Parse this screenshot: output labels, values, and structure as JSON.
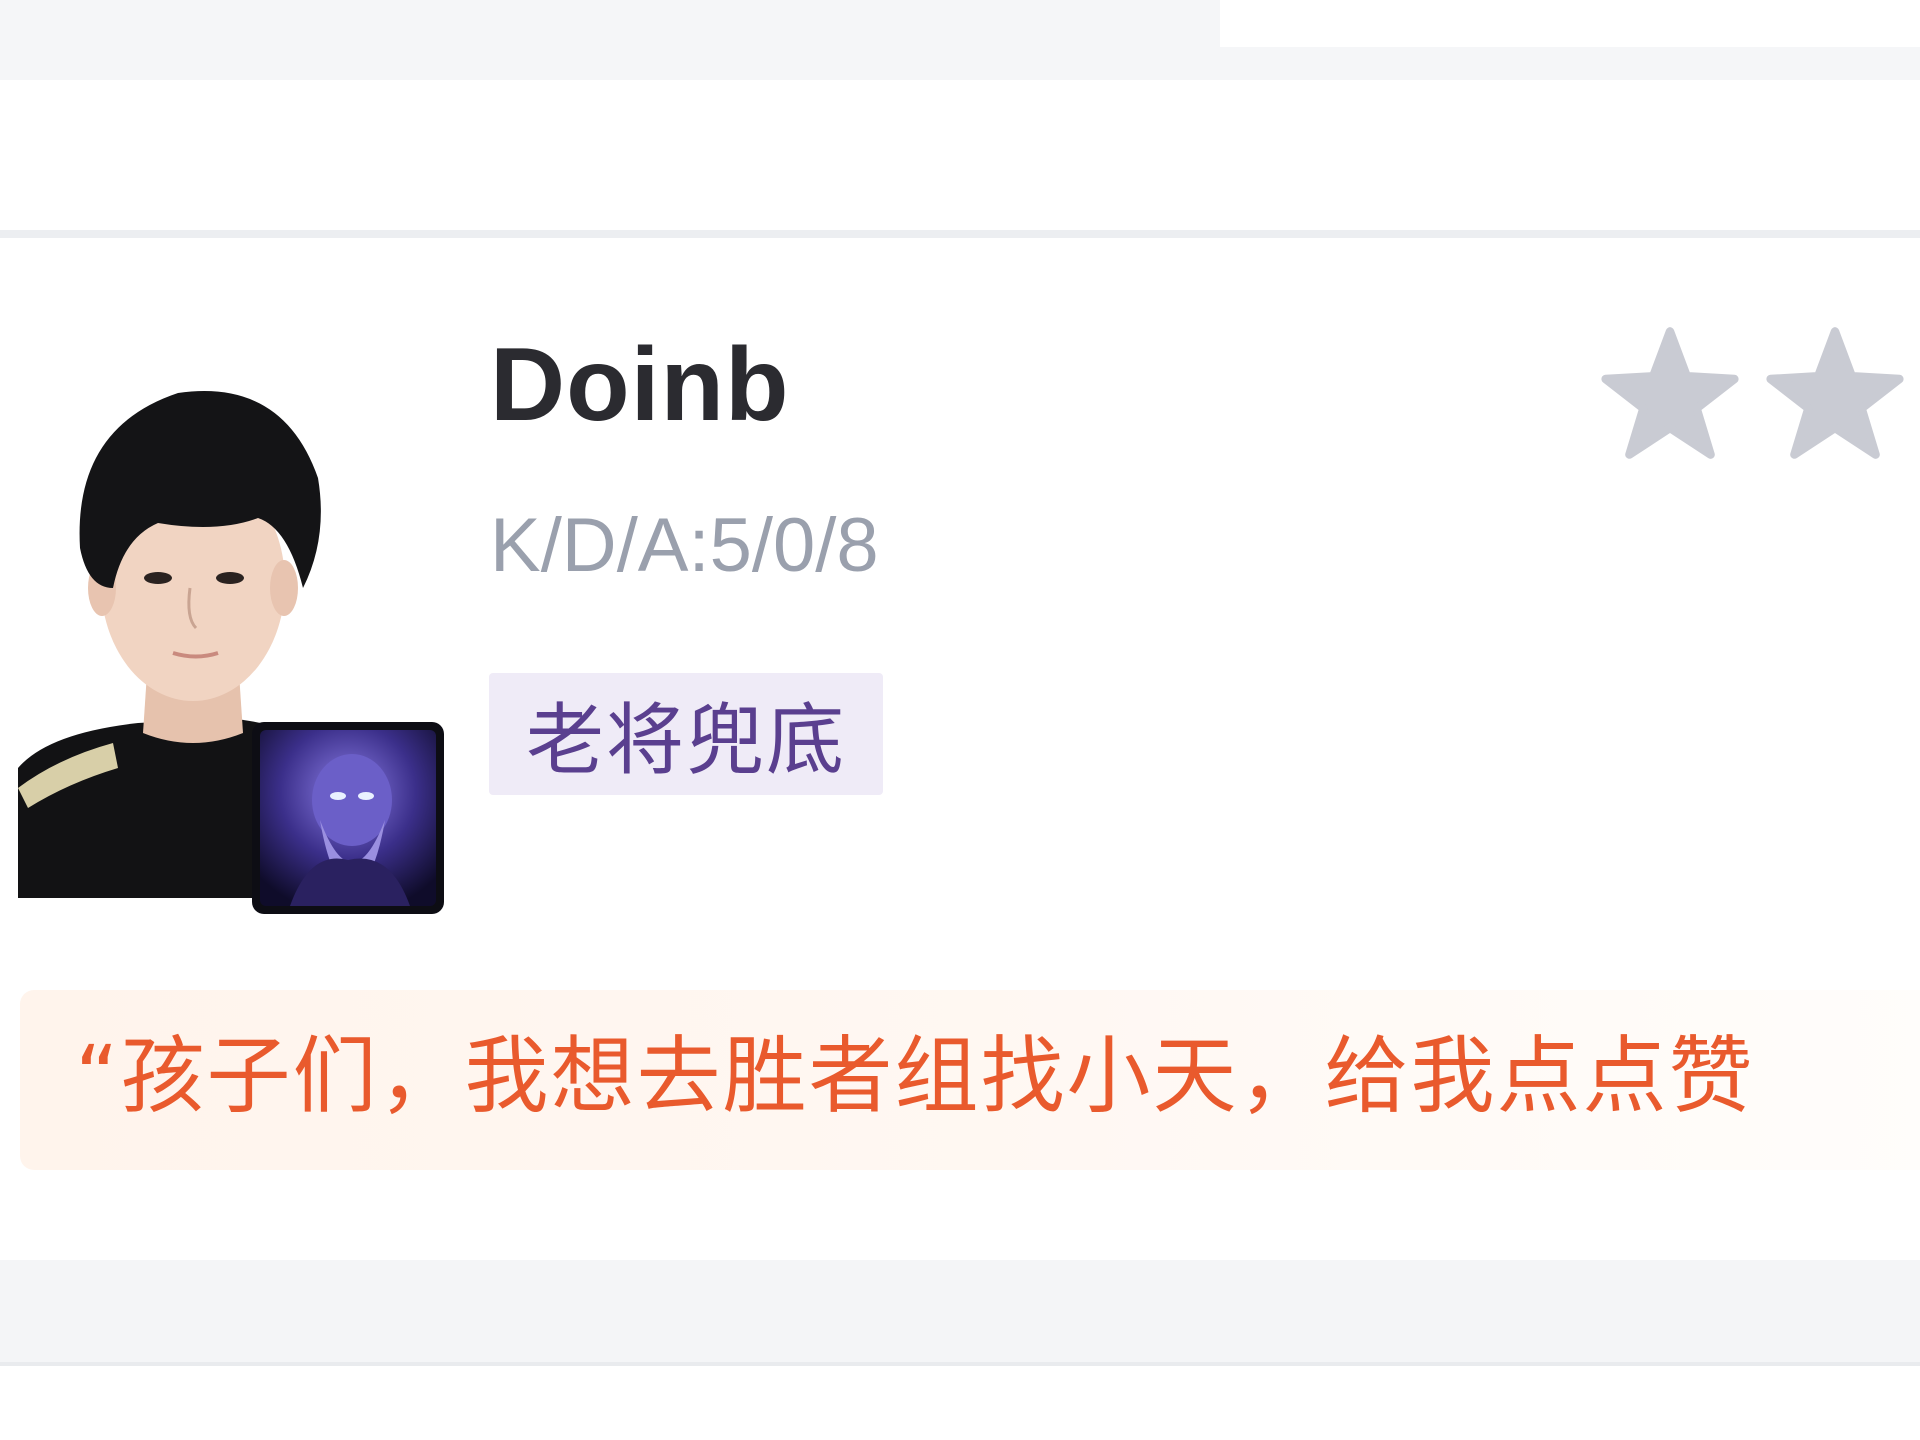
{
  "player": {
    "name": "Doinb",
    "kda": "K/D/A:5/0/8",
    "tag": "老将兜底",
    "avatar_icon": "player-avatar",
    "champion_icon": "champion-icon"
  },
  "rating": {
    "stars_visible": 2,
    "star_color": "#c9cbd3"
  },
  "quote": {
    "text": "“孩子们，我想去胜者组找小天，给我点点赞"
  },
  "colors": {
    "name": "#2b2b30",
    "kda": "#9aa0ad",
    "tag_bg": "#efebf7",
    "tag_text": "#5a3f8f",
    "quote_text": "#e95a2d",
    "quote_bg": "#fff4ec"
  }
}
